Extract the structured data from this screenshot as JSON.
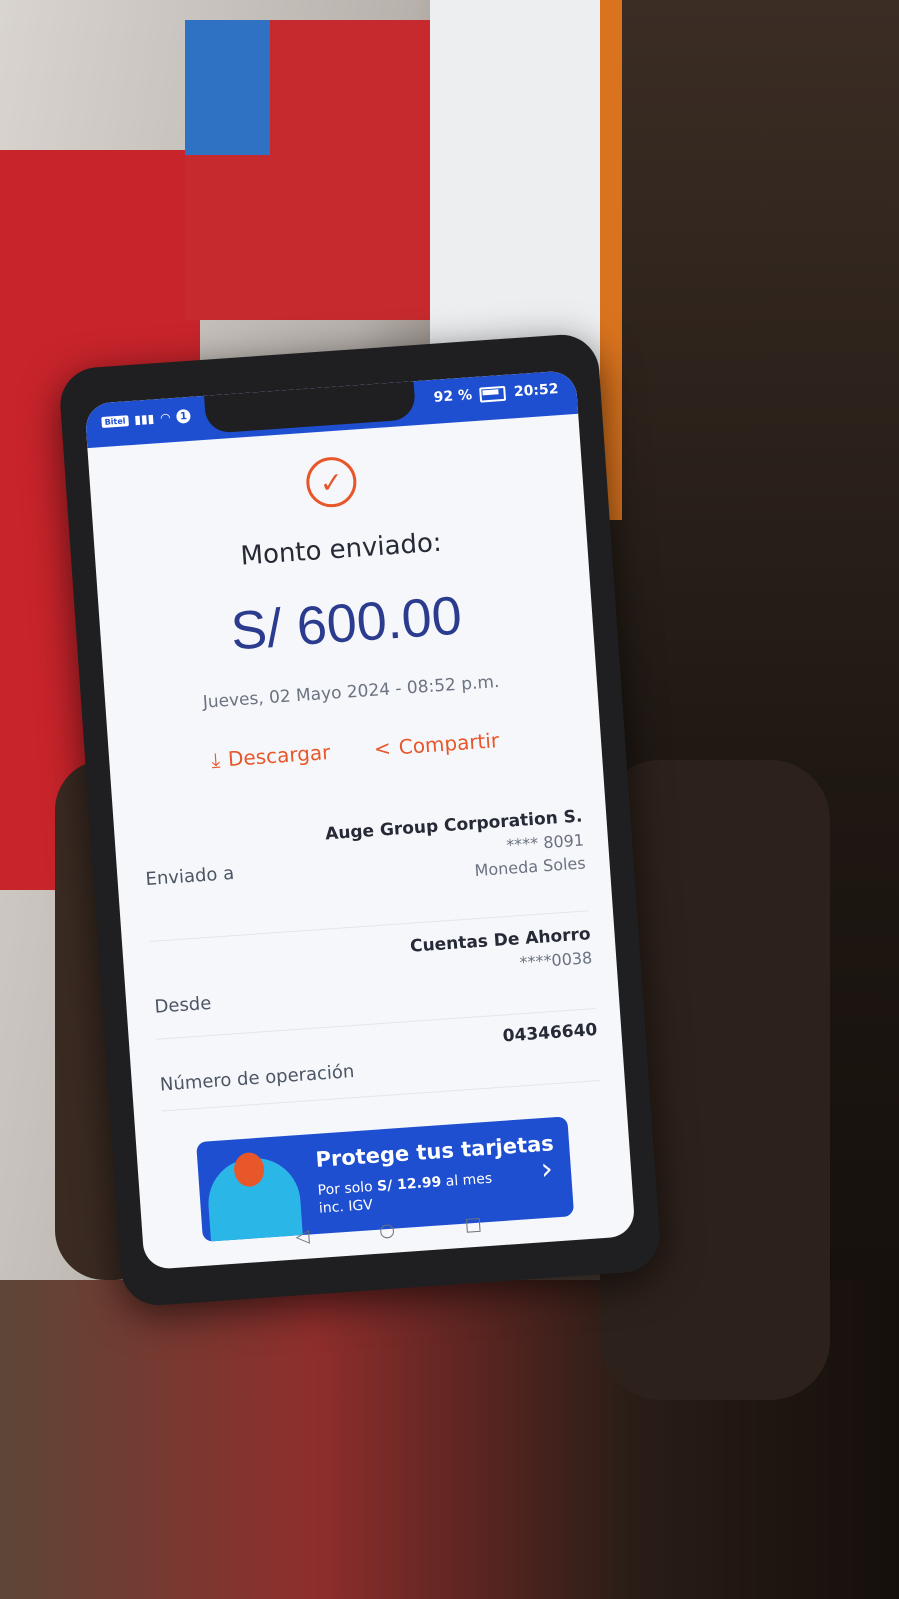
{
  "status_bar": {
    "carrier_badge": "Bitel",
    "notification_count": "1",
    "battery": "92 %",
    "time": "20:52"
  },
  "receipt": {
    "title": "Monto enviado:",
    "amount": "S/ 600.00",
    "date": "Jueves, 02 Mayo 2024 - 08:52 p.m."
  },
  "actions": {
    "download_label": "Descargar",
    "share_label": "Compartir"
  },
  "details": {
    "sent_to": {
      "label": "Enviado a",
      "name": "Auge Group Corporation S.",
      "account": "**** 8091",
      "currency": "Moneda Soles"
    },
    "from": {
      "label": "Desde",
      "account_type": "Cuentas De Ahorro",
      "account": "****0038"
    },
    "operation": {
      "label": "Número de operación",
      "number": "04346640"
    }
  },
  "promo": {
    "title": "Protege tus tarjetas",
    "line1_prefix": "Por solo ",
    "price": "S/ 12.99",
    "line1_suffix": " al mes",
    "line2": "inc. IGV"
  },
  "icons": {
    "check": "✓",
    "download": "⤓",
    "share": "<",
    "chevron": "›",
    "nav_back": "◁",
    "nav_home": "○",
    "nav_recent": "□"
  },
  "colors": {
    "accent_orange": "#e8572a",
    "brand_blue": "#1f4fd1",
    "amount_blue": "#2b3c8e"
  }
}
